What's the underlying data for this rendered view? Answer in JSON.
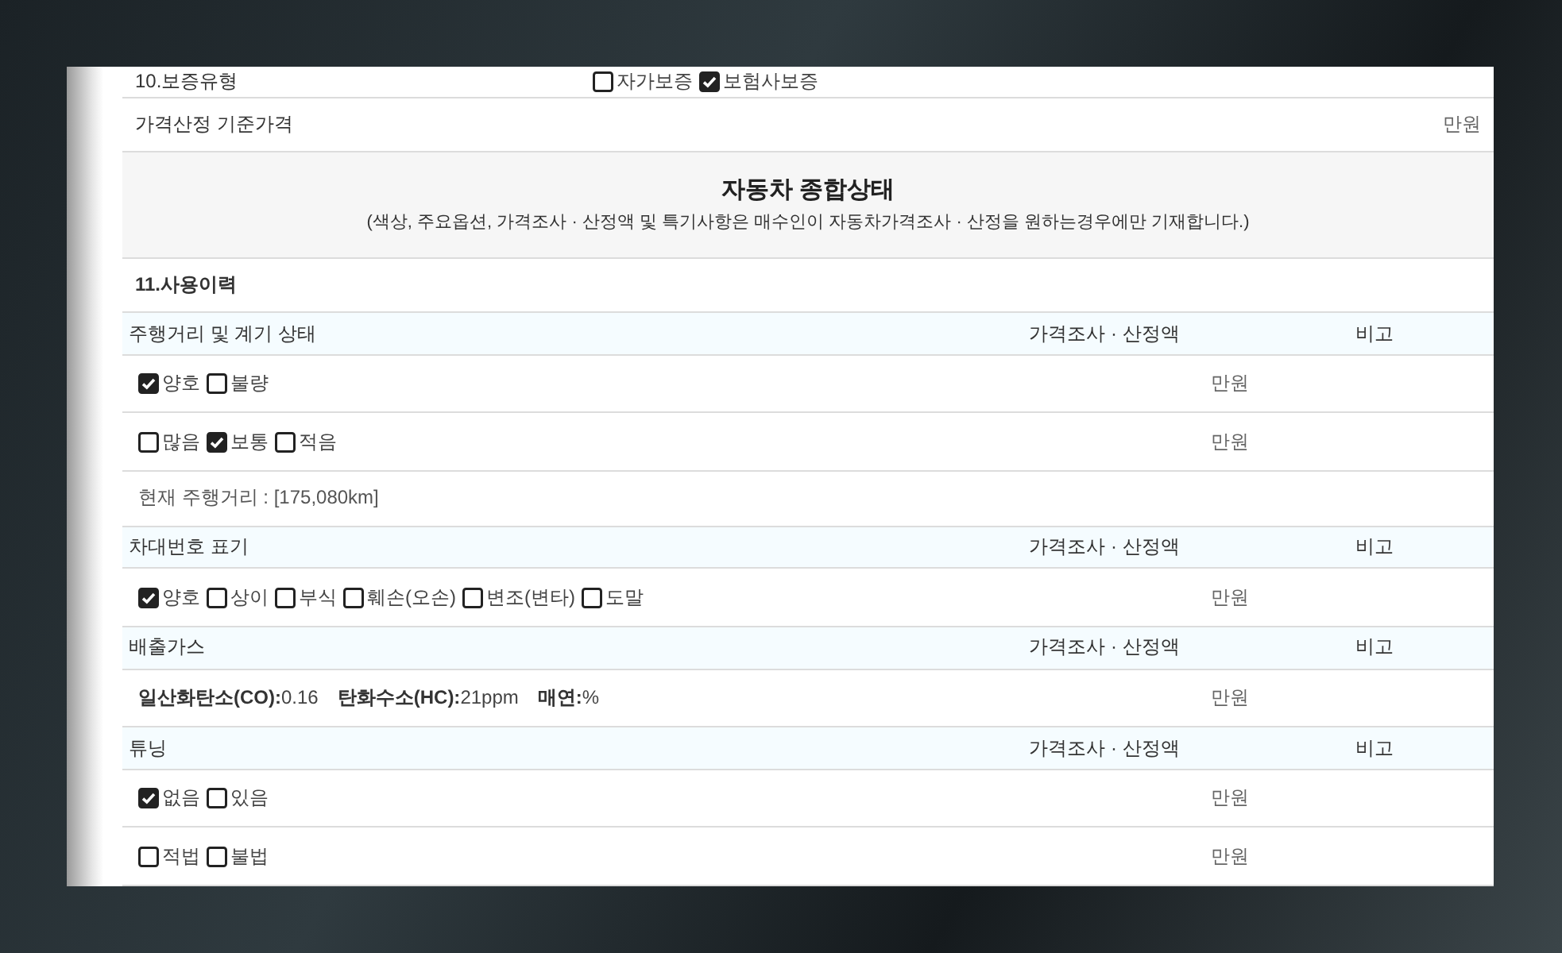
{
  "top_row": {
    "label": "10.보증유형",
    "options": [
      {
        "label": "자가보증",
        "checked": false
      },
      {
        "label": "보험사보증",
        "checked": true
      }
    ]
  },
  "base_price": {
    "label": "가격산정 기준가격",
    "unit": "만원"
  },
  "overview": {
    "title": "자동차 종합상태",
    "note": "(색상, 주요옵션, 가격조사 · 산정액 및 특기사항은 매수인이 자동차가격조사 · 산정을 원하는경우에만 기재합니다.)"
  },
  "section": {
    "title": "11.사용이력"
  },
  "groups": [
    {
      "title": "주행거리 및 계기 상태",
      "price_header": "가격조사 · 산정액",
      "remark_header": "비고",
      "rows": [
        {
          "kind": "options",
          "unit": "만원",
          "options": [
            {
              "label": "양호",
              "checked": true
            },
            {
              "label": "불량",
              "checked": false
            }
          ]
        },
        {
          "kind": "options",
          "unit": "만원",
          "options": [
            {
              "label": "많음",
              "checked": false
            },
            {
              "label": "보통",
              "checked": true
            },
            {
              "label": "적음",
              "checked": false
            }
          ]
        },
        {
          "kind": "text",
          "text": "현재 주행거리 : [175,080km]"
        }
      ]
    },
    {
      "title": "차대번호 표기",
      "price_header": "가격조사 · 산정액",
      "remark_header": "비고",
      "rows": [
        {
          "kind": "options",
          "unit": "만원",
          "options": [
            {
              "label": "양호",
              "checked": true
            },
            {
              "label": "상이",
              "checked": false
            },
            {
              "label": "부식",
              "checked": false
            },
            {
              "label": "훼손(오손)",
              "checked": false
            },
            {
              "label": "변조(변타)",
              "checked": false
            },
            {
              "label": "도말",
              "checked": false
            }
          ]
        }
      ]
    },
    {
      "title": "배출가스",
      "price_header": "가격조사 · 산정액",
      "remark_header": "비고",
      "rows": [
        {
          "kind": "readings",
          "unit": "만원",
          "readings": [
            {
              "label": "일산화탄소(CO):",
              "value": "0.16"
            },
            {
              "label": "탄화수소(HC):",
              "value": "21ppm"
            },
            {
              "label": "매연:",
              "value": "%"
            }
          ]
        }
      ]
    },
    {
      "title": "튜닝",
      "price_header": "가격조사 · 산정액",
      "remark_header": "비고",
      "rows": [
        {
          "kind": "options",
          "unit": "만원",
          "options": [
            {
              "label": "없음",
              "checked": true
            },
            {
              "label": "있음",
              "checked": false
            }
          ]
        },
        {
          "kind": "options",
          "unit": "만원",
          "options": [
            {
              "label": "적법",
              "checked": false
            },
            {
              "label": "불법",
              "checked": false
            }
          ]
        }
      ]
    }
  ]
}
